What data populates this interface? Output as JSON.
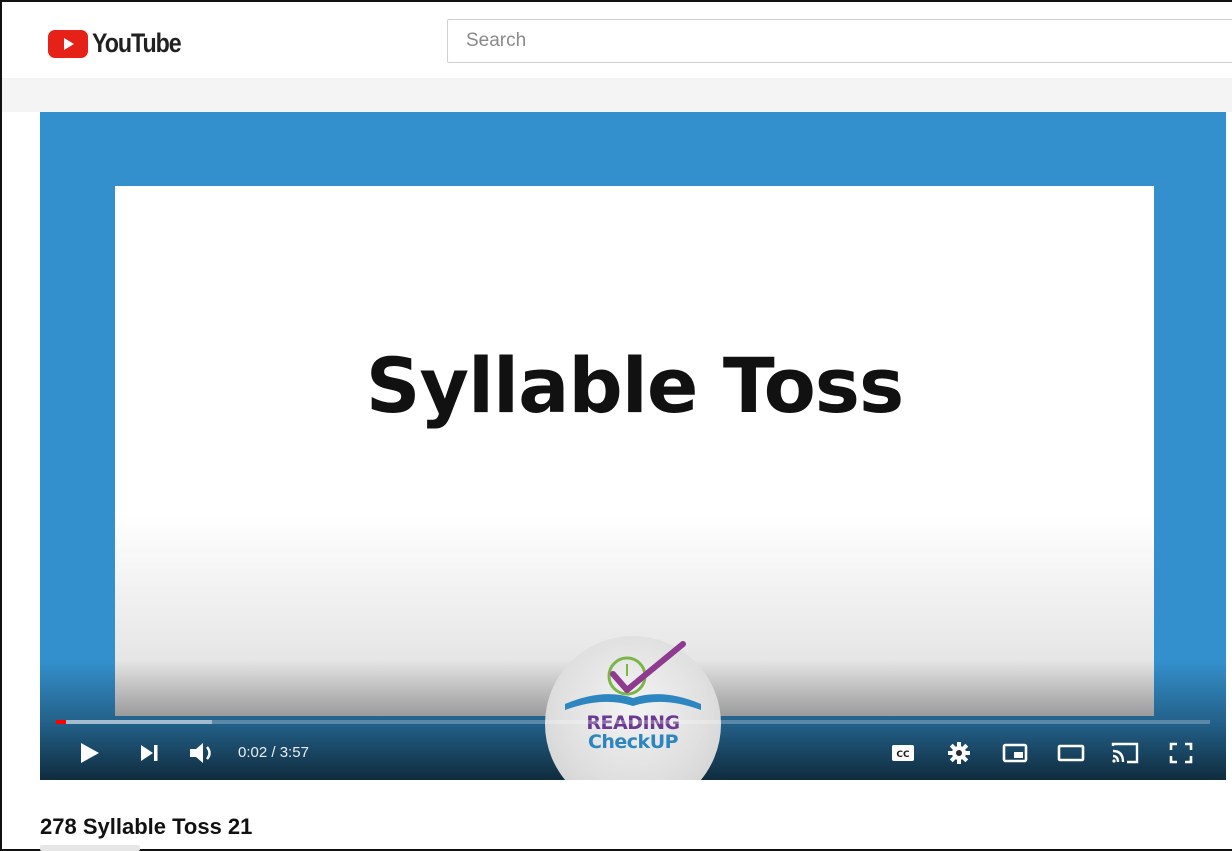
{
  "header": {
    "logo_text": "YouTube",
    "search_placeholder": "Search"
  },
  "player": {
    "slide_title": "Syllable Toss",
    "emblem": {
      "line1": "READING",
      "line2": "CheckUP"
    },
    "time_current": "0:02",
    "time_separator": " / ",
    "time_total": "3:57",
    "progress_fraction": 0.009,
    "buffered_fraction": 0.135,
    "colors": {
      "background": "#3490cd",
      "progress": "#ff0000"
    },
    "controls": [
      "play-icon",
      "next-icon",
      "volume-icon",
      "subtitles-icon",
      "settings-icon",
      "miniplayer-icon",
      "theater-icon",
      "cast-icon",
      "fullscreen-icon"
    ]
  },
  "video": {
    "title": "278 Syllable Toss 21"
  }
}
